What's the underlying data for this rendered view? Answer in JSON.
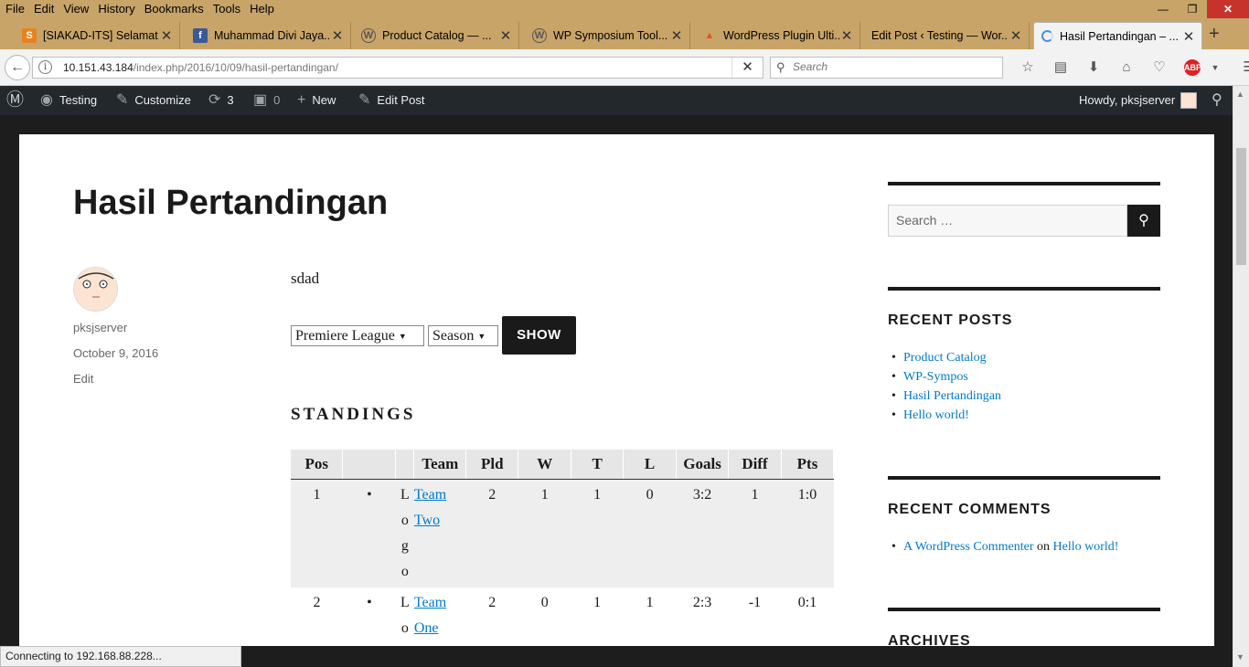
{
  "menu": [
    "File",
    "Edit",
    "View",
    "History",
    "Bookmarks",
    "Tools",
    "Help"
  ],
  "tabs": [
    {
      "title": "[SIAKAD-ITS] Selamat...",
      "icon": "siakad-icon"
    },
    {
      "title": "Muhammad Divi Jaya...",
      "icon": "facebook-icon"
    },
    {
      "title": "Product Catalog — ...",
      "icon": "wordpress-icon"
    },
    {
      "title": "WP Symposium Tool...",
      "icon": "wordpress-icon"
    },
    {
      "title": "WordPress Plugin Ulti...",
      "icon": "fire-icon"
    },
    {
      "title": "Edit Post ‹ Testing — Wor...",
      "icon": ""
    },
    {
      "title": "Hasil Pertandingan – ...",
      "icon": "loading-icon",
      "active": true
    }
  ],
  "nav": {
    "url_host": "10.151.43.184",
    "url_path": "/index.php/2016/10/09/hasil-pertandingan/",
    "search_placeholder": "Search"
  },
  "adminbar": {
    "site": "Testing",
    "customize": "Customize",
    "updates": "3",
    "comments": "0",
    "new": "New",
    "edit_post": "Edit Post",
    "howdy": "Howdy, pksjserver"
  },
  "post": {
    "title": "Hasil Pertandingan",
    "author": "pksjserver",
    "date": "October 9, 2016",
    "edit": "Edit",
    "body": "sdad",
    "league_select": "Premiere League",
    "season_select": "Season",
    "show_button": "SHOW",
    "standings_heading": "STANDINGS"
  },
  "standings": {
    "headers": [
      "Pos",
      "",
      "",
      "Team",
      "Pld",
      "W",
      "T",
      "L",
      "Goals",
      "Diff",
      "Pts"
    ],
    "rows": [
      {
        "pos": "1",
        "bullet": "•",
        "logo": [
          "L",
          "o",
          "g",
          "o"
        ],
        "team": [
          "Team",
          "Two"
        ],
        "pld": "2",
        "w": "1",
        "t": "1",
        "l": "0",
        "goals": "3:2",
        "diff": "1",
        "pts": "1:0"
      },
      {
        "pos": "2",
        "bullet": "•",
        "logo": [
          "L",
          "o"
        ],
        "team": [
          "Team",
          "One"
        ],
        "pld": "2",
        "w": "0",
        "t": "1",
        "l": "1",
        "goals": "2:3",
        "diff": "-1",
        "pts": "0:1"
      }
    ]
  },
  "sidebar": {
    "search_placeholder": "Search …",
    "recent_posts_title": "RECENT POSTS",
    "recent_posts": [
      "Product Catalog",
      "WP-Sympos",
      "Hasil Pertandingan",
      "Hello world!"
    ],
    "recent_comments_title": "RECENT COMMENTS",
    "comment_author": "A WordPress Commenter",
    "comment_on": "on",
    "comment_post": "Hello world!",
    "archives_title": "ARCHIVES"
  },
  "status": "Connecting to 192.168.88.228...",
  "colors": {
    "link": "#007acc",
    "adminbar": "#23282d",
    "titlebar": "#c8a468"
  }
}
